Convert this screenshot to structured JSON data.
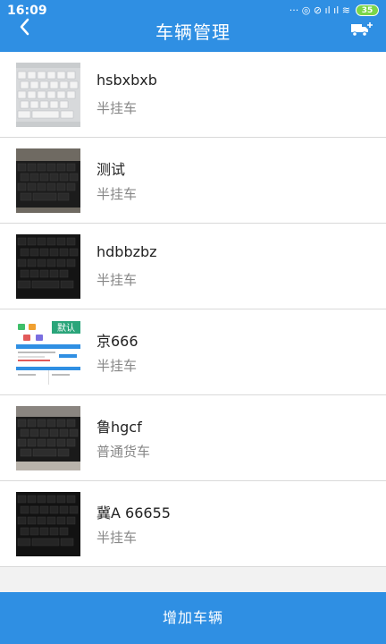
{
  "status_bar": {
    "time": "16:09",
    "icons_text": "··· ◎ ⊘ ıl ıl ≋",
    "battery": "35"
  },
  "header": {
    "title": "车辆管理"
  },
  "vehicles": [
    {
      "name": "hsbxbxb",
      "type": "半挂车",
      "thumb": "keyboard-white"
    },
    {
      "name": "测试",
      "type": "半挂车",
      "thumb": "keyboard-black"
    },
    {
      "name": "hdbbzbz",
      "type": "半挂车",
      "thumb": "keyboard-black"
    },
    {
      "name": "京666",
      "type": "半挂车",
      "thumb": "app-screenshot",
      "thumb_badge": "默认"
    },
    {
      "name": "鲁hgcf",
      "type": "普通货车",
      "thumb": "keyboard-black"
    },
    {
      "name": "冀A 66655",
      "type": "半挂车",
      "thumb": "keyboard-black"
    }
  ],
  "footer": {
    "add_label": "增加车辆"
  },
  "colors": {
    "primary": "#2f8fe3",
    "badge": "#2aa57a"
  }
}
